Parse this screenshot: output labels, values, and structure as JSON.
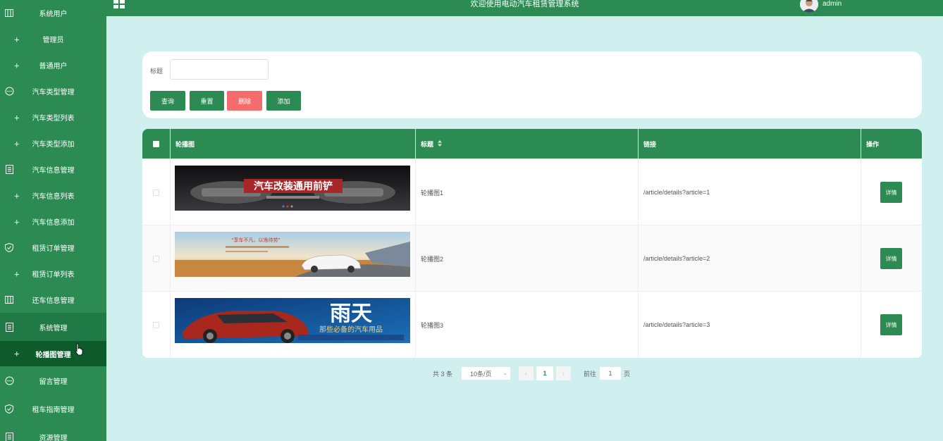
{
  "header": {
    "title": "欢迎使用电动汽车租赁管理系统",
    "user": "admin"
  },
  "sidebar": {
    "items": [
      {
        "label": "系统用户",
        "icon": "columns-icon",
        "type": "group"
      },
      {
        "label": "管理员",
        "type": "sub"
      },
      {
        "label": "普通用户",
        "type": "sub"
      },
      {
        "label": "汽车类型管理",
        "icon": "chat-icon",
        "type": "group"
      },
      {
        "label": "汽车类型列表",
        "type": "sub"
      },
      {
        "label": "汽车类型添加",
        "type": "sub"
      },
      {
        "label": "汽车信息管理",
        "icon": "document-icon",
        "type": "group"
      },
      {
        "label": "汽车信息列表",
        "type": "sub"
      },
      {
        "label": "汽车信息添加",
        "type": "sub"
      },
      {
        "label": "租赁订单管理",
        "icon": "shield-icon",
        "type": "group"
      },
      {
        "label": "租赁订单列表",
        "type": "sub"
      },
      {
        "label": "还车信息管理",
        "icon": "columns-icon",
        "type": "group"
      },
      {
        "label": "系统管理",
        "icon": "document-icon",
        "type": "group",
        "active": true
      },
      {
        "label": "轮播图管理",
        "type": "sub",
        "active": true
      },
      {
        "label": "留言管理",
        "icon": "chat-icon",
        "type": "group"
      },
      {
        "label": "租车指南管理",
        "icon": "shield-icon",
        "type": "group"
      },
      {
        "label": "资源管理",
        "icon": "document-icon",
        "type": "group"
      }
    ]
  },
  "search": {
    "label": "标题",
    "value": "",
    "query_btn": "查询",
    "reset_btn": "重置",
    "delete_btn": "删除",
    "add_btn": "添加"
  },
  "table": {
    "columns": [
      "轮播图",
      "标题",
      "链接",
      "操作"
    ],
    "rows": [
      {
        "title": "轮播图1",
        "link": "/article/details?article=1",
        "action": "详情",
        "banner_text": "汽车改装通用前铲"
      },
      {
        "title": "轮播图2",
        "link": "/article/details?article=2",
        "action": "详情",
        "banner_text": "\"享车不凡，以逸待劳\""
      },
      {
        "title": "轮播图3",
        "link": "/article/details?article=3",
        "action": "详情",
        "banner_text": "雨天",
        "banner_sub": "那些必备的汽车用品"
      }
    ]
  },
  "pagination": {
    "total": "共 3 条",
    "page_size": "10条/页",
    "current": "1",
    "goto_label": "前往",
    "goto_value": "1",
    "page_word": "页"
  },
  "colors": {
    "primary": "#2b8b53",
    "danger": "#f56c6c",
    "background": "#cff0ef"
  }
}
